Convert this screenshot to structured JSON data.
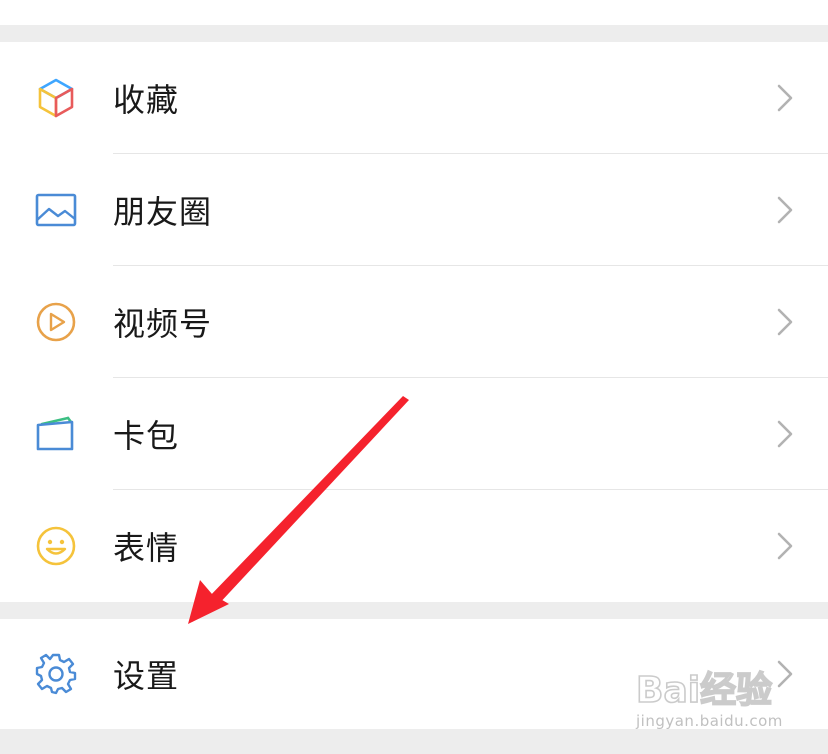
{
  "menu": {
    "items": [
      {
        "label": "收藏",
        "icon": "favorites-cube-icon"
      },
      {
        "label": "朋友圈",
        "icon": "moments-picture-icon"
      },
      {
        "label": "视频号",
        "icon": "channels-play-icon"
      },
      {
        "label": "卡包",
        "icon": "card-wallet-icon"
      },
      {
        "label": "表情",
        "icon": "sticker-smile-icon"
      }
    ],
    "settings": {
      "label": "设置",
      "icon": "gear-icon"
    }
  },
  "overlay": {
    "arrow_color": "#f5222d",
    "watermark_text": "Bai经验",
    "watermark_sub": "jingyan.baidu.com"
  },
  "colors": {
    "background": "#ededed",
    "row_background": "#ffffff",
    "text": "#191919",
    "chevron": "#b2b2b2",
    "icon_blue": "#4a8bd6",
    "icon_orange": "#e8a24a",
    "icon_yellow": "#f5c33b",
    "icon_red": "#e85b5b",
    "icon_green": "#3cbf83"
  }
}
